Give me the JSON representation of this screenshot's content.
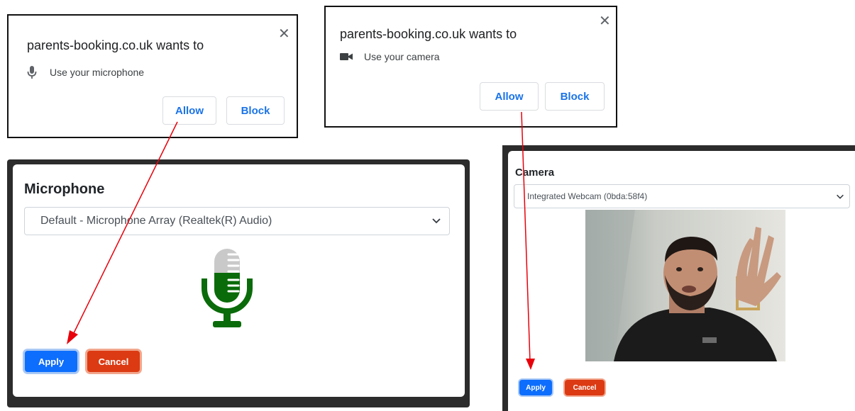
{
  "popups": [
    {
      "site": "parents-booking.co.uk wants to",
      "request": "Use your microphone",
      "icon": "microphone-icon",
      "allow_label": "Allow",
      "block_label": "Block"
    },
    {
      "site": "parents-booking.co.uk wants to",
      "request": "Use your camera",
      "icon": "camera-icon",
      "allow_label": "Allow",
      "block_label": "Block"
    }
  ],
  "microphone_dialog": {
    "heading": "Microphone",
    "selected_device": "Default - Microphone Array (Realtek(R) Audio)",
    "level_icon": "microphone-level-icon",
    "level_color": "#0a6b0a",
    "apply_label": "Apply",
    "cancel_label": "Cancel"
  },
  "camera_dialog": {
    "heading": "Camera",
    "selected_device": "Integrated Webcam (0bda:58f4)",
    "preview": "webcam-preview-image",
    "apply_label": "Apply",
    "cancel_label": "Cancel"
  },
  "colors": {
    "link_blue": "#1a73e8",
    "apply_blue": "#0d6efd",
    "cancel_red": "#dc3a12",
    "arrow_red": "#e8000b"
  }
}
